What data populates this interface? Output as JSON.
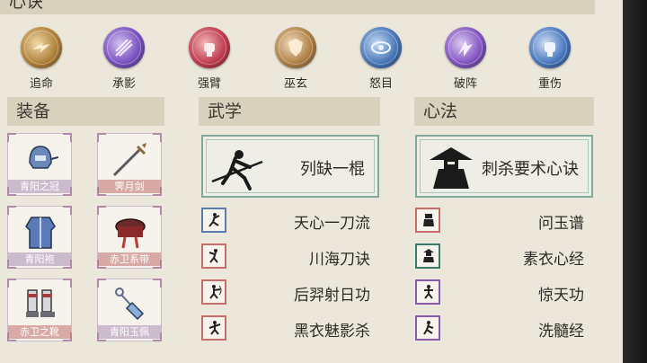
{
  "section_top": "心诀",
  "skills": [
    {
      "label": "追命",
      "color": "#a0742e",
      "icon": "rush-icon"
    },
    {
      "label": "承影",
      "color": "#7048b8",
      "icon": "shadow-icon"
    },
    {
      "label": "强臂",
      "color": "#b83a4a",
      "icon": "fist-icon"
    },
    {
      "label": "巫玄",
      "color": "#a0743a",
      "icon": "shield-icon"
    },
    {
      "label": "怒目",
      "color": "#3a6aa8",
      "icon": "eye-icon"
    },
    {
      "label": "破阵",
      "color": "#7a4ab8",
      "icon": "break-icon"
    },
    {
      "label": "重伤",
      "color": "#3a6ab0",
      "icon": "wound-icon"
    }
  ],
  "sections": {
    "equipment": "装备",
    "martial": "武学",
    "mind": "心法"
  },
  "equipment": [
    {
      "name": "青阳之冠",
      "icon": "helmet-icon"
    },
    {
      "name": "霁月剑",
      "icon": "sword-icon"
    },
    {
      "name": "青阳袍",
      "icon": "robe-icon"
    },
    {
      "name": "赤卫系带",
      "icon": "belt-icon"
    },
    {
      "name": "赤卫之靴",
      "icon": "boots-icon"
    },
    {
      "name": "青阳玉佩",
      "icon": "pendant-icon"
    }
  ],
  "martial": {
    "featured": "列缺一棍",
    "list": [
      "天心一刀流",
      "川海刀诀",
      "后羿射日功",
      "黑衣魅影杀"
    ]
  },
  "mind": {
    "featured": "刺杀要术心诀",
    "list": [
      "问玉谱",
      "素衣心经",
      "惊天功",
      "洗髓经"
    ]
  },
  "colors": {
    "panel": "#ebe7da",
    "header": "#d8d1bd",
    "teal_border": "#7fa99a",
    "red_border": "#c86b6b",
    "blue_border": "#5a7ab0",
    "green_border": "#3a7a6a",
    "purple_border": "#8a5ab0"
  }
}
